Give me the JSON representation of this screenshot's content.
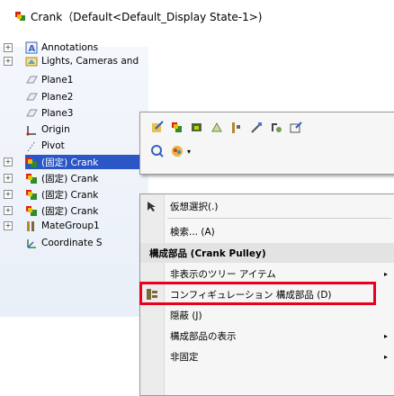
{
  "tree": {
    "title": "Crank（Default<Default_Display State-1>)",
    "items": [
      {
        "label": "Annotations",
        "icon": "annotations-icon",
        "expander": "+"
      },
      {
        "label": "Lights, Cameras and Scene",
        "icon": "lights-icon",
        "expander": "+"
      },
      {
        "label": "Plane1",
        "icon": "plane-icon",
        "expander": ""
      },
      {
        "label": "Plane2",
        "icon": "plane-icon",
        "expander": ""
      },
      {
        "label": "Plane3",
        "icon": "plane-icon",
        "expander": ""
      },
      {
        "label": "Origin",
        "icon": "origin-icon",
        "expander": ""
      },
      {
        "label": "Pivot",
        "icon": "axis-icon",
        "expander": ""
      },
      {
        "label": "(固定) Crank",
        "icon": "component-icon",
        "expander": "+"
      },
      {
        "label": "(固定) Crank",
        "icon": "component-icon",
        "expander": "+"
      },
      {
        "label": "(固定) Crank",
        "icon": "component-icon",
        "expander": "+"
      },
      {
        "label": "(固定) Crank",
        "icon": "component-icon",
        "expander": "+"
      },
      {
        "label": "MateGroup1",
        "icon": "mates-icon",
        "expander": "+"
      },
      {
        "label": "Coordinate S",
        "icon": "coordinate-icon",
        "expander": ""
      }
    ]
  },
  "context_menu": {
    "items": [
      {
        "label": "仮想選択(.)",
        "icon": "select-icon",
        "arrow": ""
      },
      {
        "label": "検索... (A)",
        "icon": "",
        "arrow": ""
      }
    ],
    "header": "構成部品 (Crank Pulley)",
    "sub_items": [
      {
        "label": "非表示のツリー アイテム",
        "icon": "",
        "arrow": "▸"
      },
      {
        "label": "コンフィギュレーション 構成部品 (D)",
        "icon": "config-icon",
        "arrow": "",
        "highlighted": true
      },
      {
        "label": "隠蔽 (J)",
        "icon": "",
        "arrow": ""
      },
      {
        "label": "構成部品の表示",
        "icon": "",
        "arrow": "▸"
      },
      {
        "label": "非固定",
        "icon": "",
        "arrow": "▸"
      }
    ]
  },
  "colors": {
    "selection": "#2a56c6",
    "highlight_border": "#e8001c",
    "menu_bg": "#f6f6f6"
  }
}
